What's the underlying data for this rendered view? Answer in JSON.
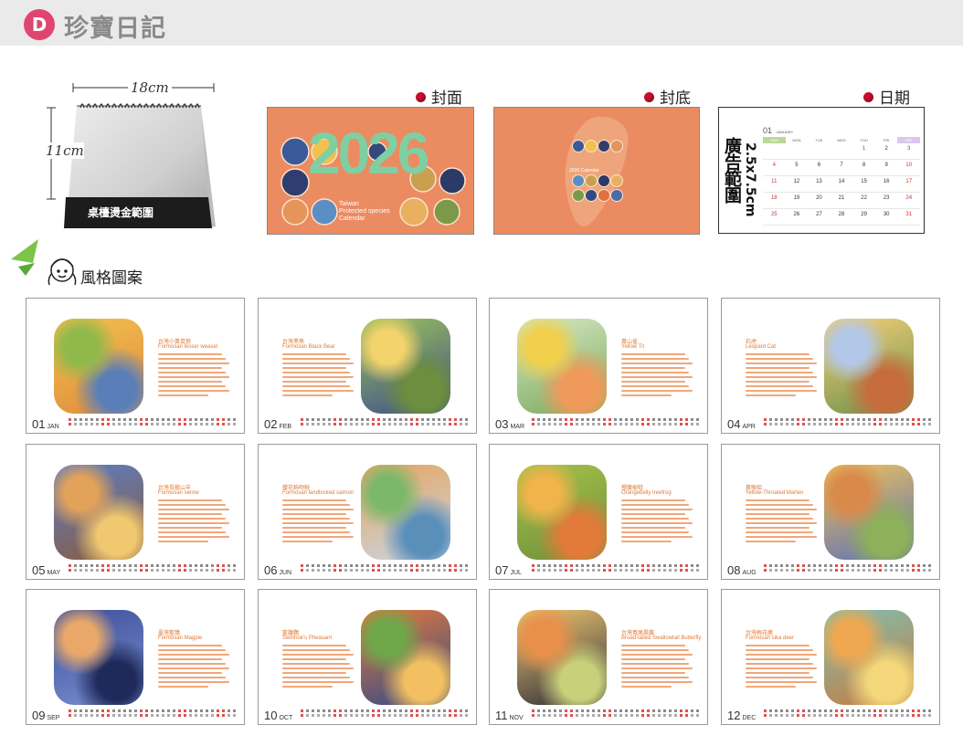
{
  "header": {
    "badge_letter": "D",
    "title": "珍寶日記"
  },
  "stand": {
    "width_label": "18cm",
    "height_label": "11cm",
    "band_label": "桌檯燙金範圍"
  },
  "sections": {
    "cover": "封面",
    "back": "封底",
    "date": "日期",
    "style": "風格圖案"
  },
  "cover": {
    "year": "2026",
    "subtitle_line1": "Taiwan",
    "subtitle_line2": "Protected species",
    "subtitle_line3": "Calendar"
  },
  "back": {
    "caption": "2026 Calendar"
  },
  "date_panel": {
    "ad_title": "廣告範圍",
    "ad_size": "2.5x7.5cm",
    "month_num": "01",
    "month_name": "JANUARY",
    "weekdays": [
      "SUN",
      "MON",
      "TUE",
      "WED",
      "THU",
      "FRI",
      "SAT"
    ],
    "weeks": [
      [
        "",
        "",
        "",
        "",
        "1",
        "2",
        "3"
      ],
      [
        "4",
        "5",
        "6",
        "7",
        "8",
        "9",
        "10"
      ],
      [
        "11",
        "12",
        "13",
        "14",
        "15",
        "16",
        "17"
      ],
      [
        "18",
        "19",
        "20",
        "21",
        "22",
        "23",
        "24"
      ],
      [
        "25",
        "26",
        "27",
        "28",
        "29",
        "30",
        "31"
      ]
    ]
  },
  "months": [
    {
      "num": "01",
      "abbr": "JAN",
      "zh": "台灣小黃鼠狼",
      "en": "Formosan lesser weasel",
      "layout": "left",
      "palette": [
        "#f2c14e",
        "#8fb94b",
        "#e08a3c",
        "#5a7fb8"
      ]
    },
    {
      "num": "02",
      "abbr": "FEB",
      "zh": "台灣黑熊",
      "en": "Formosan Black Bear",
      "layout": "right",
      "palette": [
        "#9bc25a",
        "#f3d36b",
        "#3d4e8c",
        "#6c8e3e"
      ]
    },
    {
      "num": "03",
      "abbr": "MAR",
      "zh": "黃山雀",
      "en": "Yellow Tit",
      "layout": "left",
      "palette": [
        "#d7e8c4",
        "#f2d04c",
        "#7aa95b",
        "#ef9a5a"
      ]
    },
    {
      "num": "04",
      "abbr": "APR",
      "zh": "石虎",
      "en": "Leopard Cat",
      "layout": "right",
      "palette": [
        "#f4d07a",
        "#b3c8e8",
        "#6e8f4a",
        "#c66c3c"
      ]
    },
    {
      "num": "05",
      "abbr": "MAY",
      "zh": "台灣長鬃山羊",
      "en": "Formosan serow",
      "layout": "left",
      "palette": [
        "#5b7fc4",
        "#e2a25a",
        "#8a5a3c",
        "#f0c870"
      ]
    },
    {
      "num": "06",
      "abbr": "JUN",
      "zh": "櫻花鉤吻鮭",
      "en": "Formosan landlocked salmon",
      "layout": "right",
      "palette": [
        "#e7a45c",
        "#7bb86a",
        "#c9d7e8",
        "#5a8fba"
      ]
    },
    {
      "num": "07",
      "abbr": "JUL",
      "zh": "橙腹樹蛙",
      "en": "Orangebelly treefrog",
      "layout": "left",
      "palette": [
        "#a6c24a",
        "#f0b44a",
        "#6f8f3a",
        "#e27a3a"
      ]
    },
    {
      "num": "08",
      "abbr": "AUG",
      "zh": "黃喉貂",
      "en": "Yellow-Throated Marten",
      "layout": "right",
      "palette": [
        "#f0c45a",
        "#d9894a",
        "#5b6fb8",
        "#8fb05a"
      ]
    },
    {
      "num": "09",
      "abbr": "SEP",
      "zh": "臺灣藍鵲",
      "en": "Formosan Magpie",
      "layout": "left",
      "palette": [
        "#3d4f9a",
        "#e9a86a",
        "#7a8fd0",
        "#1f2a5a"
      ]
    },
    {
      "num": "10",
      "abbr": "OCT",
      "zh": "藍腹鷴",
      "en": "Swinhoe's Pheasant",
      "layout": "right",
      "palette": [
        "#e57a3a",
        "#6ea84a",
        "#2f4a8a",
        "#f2c060"
      ]
    },
    {
      "num": "11",
      "abbr": "NOV",
      "zh": "台灣寬尾鳳蝶",
      "en": "Broad-tailed Swallowtail Butterfly",
      "layout": "left",
      "palette": [
        "#f0c870",
        "#e8904a",
        "#2a2a3a",
        "#c9d07a"
      ]
    },
    {
      "num": "12",
      "abbr": "DEC",
      "zh": "台灣梅花鹿",
      "en": "Formosan sika deer",
      "layout": "right",
      "palette": [
        "#7fc0b0",
        "#f0a850",
        "#c87a40",
        "#f3d77a"
      ]
    }
  ]
}
